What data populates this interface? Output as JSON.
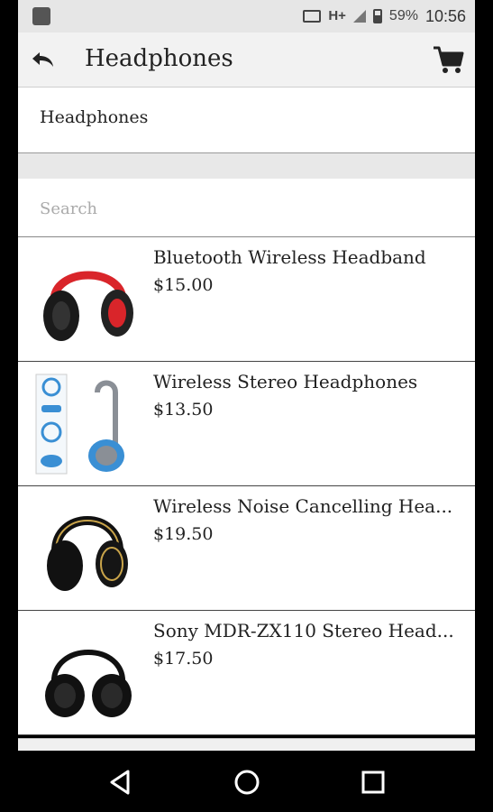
{
  "status_bar": {
    "battery": "59%",
    "time": "10:56",
    "network": "H+"
  },
  "app_bar": {
    "title": "Headphones"
  },
  "category": {
    "label": "Headphones"
  },
  "search": {
    "placeholder": "Search"
  },
  "products": [
    {
      "name": "Bluetooth Wireless Headband",
      "price": "$15.00",
      "accent": "#d9252a",
      "body": "#222222"
    },
    {
      "name": "Wireless Stereo Headphones",
      "price": "$13.50",
      "accent": "#3a8fd4",
      "body": "#8a8f96"
    },
    {
      "name": "Wireless Noise Cancelling Hea...",
      "price": "$19.50",
      "accent": "#c9a44a",
      "body": "#111111"
    },
    {
      "name": "Sony MDR-ZX110 Stereo Head...",
      "price": "$17.50",
      "accent": "#444444",
      "body": "#111111"
    }
  ],
  "colors": {
    "appbar_bg": "#f2f2f2",
    "status_bg": "#e6e6e6",
    "text": "#222222"
  }
}
